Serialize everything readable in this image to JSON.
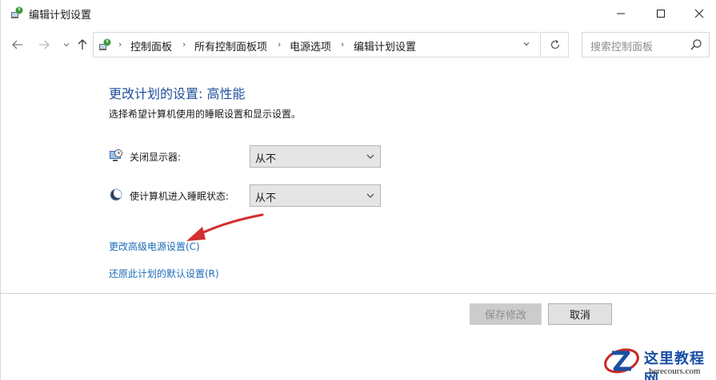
{
  "window": {
    "title": "编辑计划设置"
  },
  "nav": {
    "breadcrumbs": [
      "控制面板",
      "所有控制面板项",
      "电源选项",
      "编辑计划设置"
    ],
    "search_placeholder": "搜索控制面板"
  },
  "content": {
    "heading": "更改计划的设置: 高性能",
    "subheading": "选择希望计算机使用的睡眠设置和显示设置。",
    "settings": [
      {
        "label": "关闭显示器:",
        "value": "从不",
        "icon": "monitor-icon"
      },
      {
        "label": "使计算机进入睡眠状态:",
        "value": "从不",
        "icon": "moon-icon"
      }
    ],
    "links": {
      "advanced": "更改高级电源设置(C)",
      "restore": "还原此计划的默认设置(R)"
    }
  },
  "buttons": {
    "save": "保存修改",
    "cancel": "取消"
  },
  "watermark": {
    "title": "这里教程网",
    "url": "herecours.com"
  },
  "colors": {
    "heading": "#1f4e9c",
    "link": "#1e6bb8",
    "arrow": "#d32f2f",
    "watermark": "#1a4ea3"
  }
}
